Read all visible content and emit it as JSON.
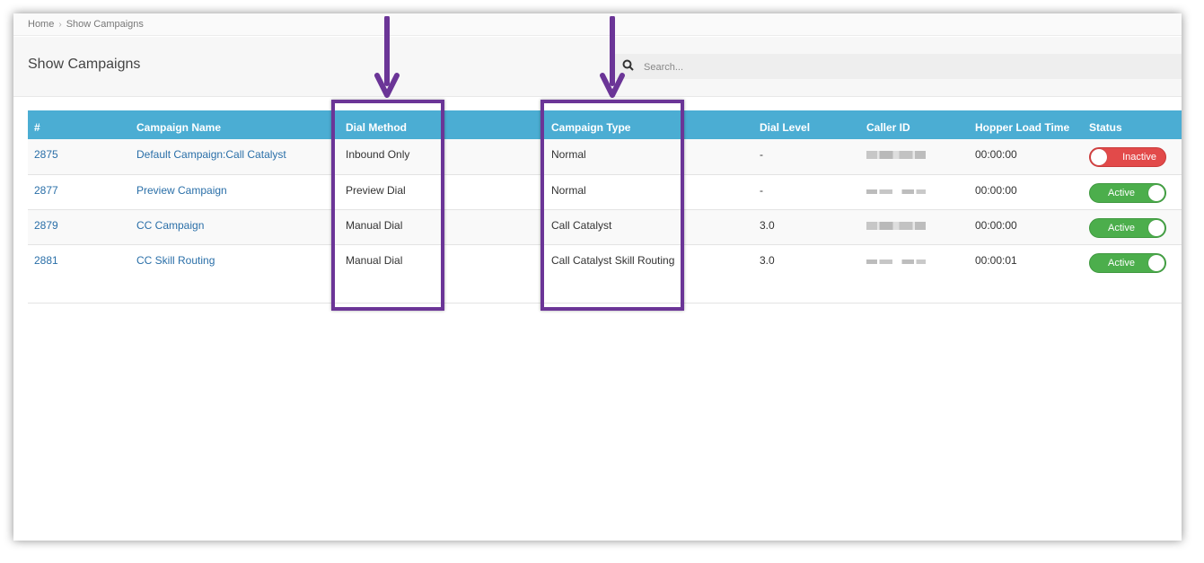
{
  "breadcrumb": {
    "home": "Home",
    "current": "Show Campaigns"
  },
  "page_title": "Show Campaigns",
  "search": {
    "placeholder": "Search...",
    "value": ""
  },
  "table": {
    "headers": [
      "#",
      "Campaign Name",
      "Dial Method",
      "Campaign Type",
      "Dial Level",
      "Caller ID",
      "Hopper Load Time",
      "Status"
    ],
    "rows": [
      {
        "id": "2875",
        "name": "Default Campaign:Call Catalyst",
        "dial_method": "Inbound Only",
        "type": "Normal",
        "dial_level": "-",
        "caller_id": "redacted",
        "hopper": "00:00:00",
        "status": "Inactive"
      },
      {
        "id": "2877",
        "name": "Preview Campaign",
        "dial_method": "Preview Dial",
        "type": "Normal",
        "dial_level": "-",
        "caller_id": "redacted",
        "hopper": "00:00:00",
        "status": "Active"
      },
      {
        "id": "2879",
        "name": "CC Campaign",
        "dial_method": "Manual Dial",
        "type": "Call Catalyst",
        "dial_level": "3.0",
        "caller_id": "redacted",
        "hopper": "00:00:00",
        "status": "Active"
      },
      {
        "id": "2881",
        "name": "CC Skill Routing",
        "dial_method": "Manual Dial",
        "type": "Call Catalyst Skill Routing",
        "dial_level": "3.0",
        "caller_id": "redacted",
        "hopper": "00:00:01",
        "status": "Active"
      }
    ]
  },
  "colors": {
    "header": "#4badd3",
    "active": "#4cae4c",
    "inactive": "#e24a4a",
    "highlight": "#6b3597",
    "link": "#2a6fa8"
  }
}
